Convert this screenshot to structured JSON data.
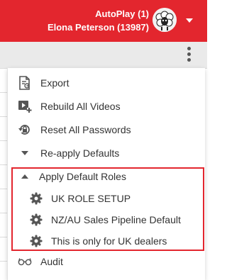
{
  "header": {
    "line1": "AutoPlay (1)",
    "line2": "Elona Peterson (13987)",
    "avatar_icon": "user-avatar-sheep",
    "dropdown_icon": "caret-down-icon",
    "background_color": "#e3262e"
  },
  "toolbar": {
    "more_icon": "kebab-menu-icon"
  },
  "menu": {
    "export": {
      "label": "Export",
      "icon": "export-document-icon"
    },
    "rebuild": {
      "label": "Rebuild All Videos",
      "icon": "video-plus-icon"
    },
    "reset": {
      "label": "Reset All Passwords",
      "icon": "lock-reset-icon"
    },
    "reapply": {
      "label": "Re-apply Defaults",
      "icon": "caret-down-icon"
    },
    "apply_roles": {
      "label": "Apply Default Roles",
      "icon": "caret-up-icon",
      "children": [
        {
          "label": "UK ROLE SETUP",
          "icon": "gear-icon"
        },
        {
          "label": "NZ/AU Sales Pipeline Default",
          "icon": "gear-icon"
        },
        {
          "label": "This is only for UK dealers",
          "icon": "gear-icon"
        }
      ]
    },
    "audit": {
      "label": "Audit",
      "icon": "glasses-icon"
    }
  },
  "colors": {
    "brand_red": "#e3262e",
    "text": "#333333",
    "icon": "#555555"
  }
}
